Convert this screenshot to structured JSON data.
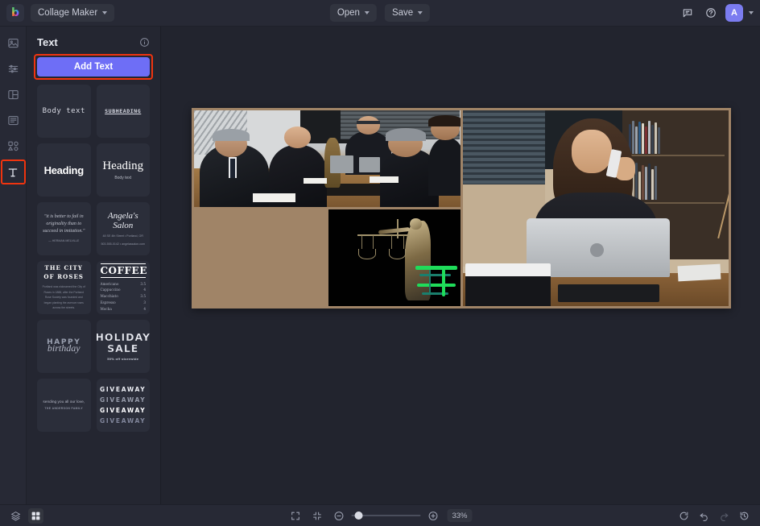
{
  "app": {
    "logo_glyph": "b",
    "document_name": "Collage Maker"
  },
  "topbar": {
    "open_label": "Open",
    "save_label": "Save",
    "avatar_initial": "A"
  },
  "rail": {
    "items": [
      {
        "name": "image-tool",
        "label": "Image"
      },
      {
        "name": "adjust-tool",
        "label": "Adjust"
      },
      {
        "name": "layout-tool",
        "label": "Layout"
      },
      {
        "name": "layers-tool",
        "label": "Layers"
      },
      {
        "name": "elements-tool",
        "label": "Elements"
      },
      {
        "name": "text-tool",
        "label": "Text"
      }
    ]
  },
  "panel": {
    "title": "Text",
    "add_text_label": "Add Text",
    "presets": [
      {
        "id": "body-text",
        "text": "Body text"
      },
      {
        "id": "subheading",
        "text": "SUBHEADING"
      },
      {
        "id": "heading-bold",
        "text": "Heading"
      },
      {
        "id": "heading-serif",
        "text": "Heading",
        "sub": "Body text"
      },
      {
        "id": "quote-script",
        "text": "\"it is better to fail in originality than to succeed in imitation.\"",
        "sub": "— HERMAN MELVILLE"
      },
      {
        "id": "salon-script",
        "text": "Angela's Salon",
        "sub": "48 SE 4th Street • Portland, OR",
        "sub2": "503-555-0142 • angelassalon.com"
      },
      {
        "id": "city-of-roses",
        "text": "THE CITY\nOF ROSES",
        "sub": "Portland was nicknamed the City of Roses in 1888, after the Portland Rose Society was founded and began planting the avenue roses across the streets."
      },
      {
        "id": "coffee-menu",
        "text": "COFFEE",
        "items": [
          {
            "name": "Americano",
            "price": "3.5"
          },
          {
            "name": "Cappuccino",
            "price": "4"
          },
          {
            "name": "Macchiato",
            "price": "3.5"
          },
          {
            "name": "Espresso",
            "price": "3"
          },
          {
            "name": "Mocha",
            "price": "4"
          }
        ]
      },
      {
        "id": "happy-birthday",
        "text": "HAPPY",
        "sub": "birthday"
      },
      {
        "id": "holiday-sale",
        "text": "HOLIDAY\nSALE",
        "sub": "50% off storewide"
      },
      {
        "id": "sending-love",
        "text": "sending you all our love,",
        "sub": "THE ANDERSON FAMILY"
      },
      {
        "id": "giveaway",
        "lines": [
          "GIVEAWAY",
          "GIVEAWAY",
          "GIVEAWAY",
          "GIVEAWAY"
        ]
      }
    ]
  },
  "canvas": {
    "collage_background": "#a08467",
    "cells": [
      {
        "id": "cell-meeting",
        "caption": "Law office meeting with five people at a conference table"
      },
      {
        "id": "cell-blank",
        "caption": "Empty collage cell"
      },
      {
        "id": "cell-justice",
        "caption": "Lady Justice statue holding scales on black background"
      },
      {
        "id": "cell-woman",
        "caption": "Woman on phone working at a laptop in front of bookshelves"
      }
    ]
  },
  "bottombar": {
    "zoom_value": "33%",
    "slider_position_percent": 10,
    "buttons": {
      "layers": "Layers",
      "grid": "Grid",
      "fit": "Fit to screen",
      "fullscreen": "Fullscreen",
      "zoom_out": "Zoom out",
      "zoom_in": "Zoom in",
      "reset": "Reset",
      "undo": "Undo",
      "redo": "Redo",
      "history": "History"
    }
  },
  "highlight_color": "#f0340f"
}
